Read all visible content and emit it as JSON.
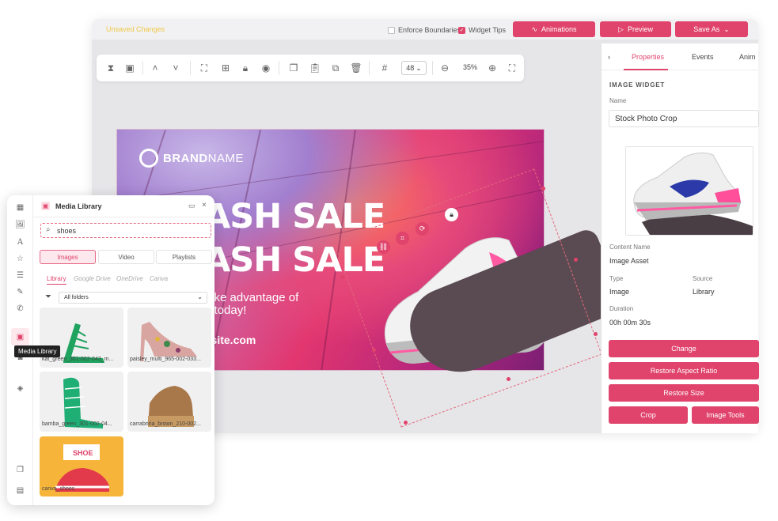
{
  "topbar": {
    "unsaved": "Unsaved Changes",
    "enforce_boundaries": "Enforce Boundaries",
    "widget_tips": "Widget Tips",
    "animations": "Animations",
    "preview": "Preview",
    "save_as": "Save As"
  },
  "toolbar": {
    "grid_size": "48",
    "zoom": "35%"
  },
  "canvas": {
    "brand_bold": "BRAND",
    "brand_thin": "NAME",
    "headline_1": "ASH SALE",
    "headline_2": "ASH SALE",
    "tagline_1": "take advantage of",
    "tagline_2": "e today!",
    "website": "bsite.com"
  },
  "properties": {
    "tabs": [
      "Properties",
      "Events",
      "Anim"
    ],
    "section_title": "IMAGE WIDGET",
    "name_label": "Name",
    "name_value": "Stock Photo Crop",
    "content_name_label": "Content Name",
    "content_name_value": "Image Asset",
    "type_label": "Type",
    "type_value": "Image",
    "source_label": "Source",
    "source_value": "Library",
    "duration_label": "Duration",
    "duration_value": "00h 00m 30s",
    "buttons": {
      "change": "Change",
      "restore_aspect": "Restore Aspect Ratio",
      "restore_size": "Restore Size",
      "crop": "Crop",
      "image_tools": "Image Tools"
    }
  },
  "media_library": {
    "title": "Media Library",
    "search_value": "shoes",
    "segments": [
      "Images",
      "Video",
      "Playlists"
    ],
    "sources": [
      "Library",
      "Google Drive",
      "OneDrive",
      "Canva"
    ],
    "folder_select": "All folders",
    "tooltip": "Media Library",
    "items": [
      "kat_green_301-002-043_m...",
      "paisley_multi_965-002-033...",
      "bamba_green_301-002-04...",
      "carrabriria_brown_210-002...",
      "canva_shoes"
    ]
  },
  "colors": {
    "accent": "#e0436b",
    "unsaved": "#f0c94a"
  }
}
